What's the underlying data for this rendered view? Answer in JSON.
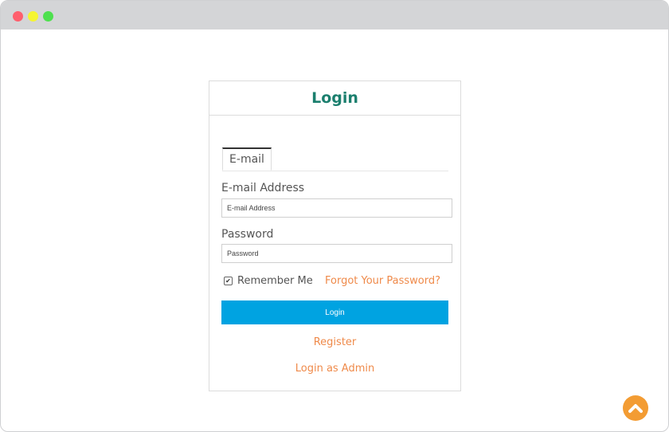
{
  "window": {
    "controls": [
      "close",
      "minimize",
      "maximize"
    ]
  },
  "card": {
    "title": "Login",
    "tabs": [
      {
        "label": "E-mail",
        "active": true
      }
    ],
    "email": {
      "label": "E-mail Address",
      "placeholder": "E-mail Address",
      "value": ""
    },
    "password": {
      "label": "Password",
      "placeholder": "Password",
      "value": ""
    },
    "remember": {
      "label": "Remember Me",
      "checked": true
    },
    "forgot_link": "Forgot Your Password?",
    "login_button": "Login",
    "register_link": "Register",
    "admin_link": "Login as Admin"
  },
  "icons": {
    "scroll_top": "chevron-up-icon"
  },
  "colors": {
    "title": "#1b7f6e",
    "accent": "#00a3e1",
    "link": "#ef8a4a",
    "scroll_top": "#f39c33"
  }
}
